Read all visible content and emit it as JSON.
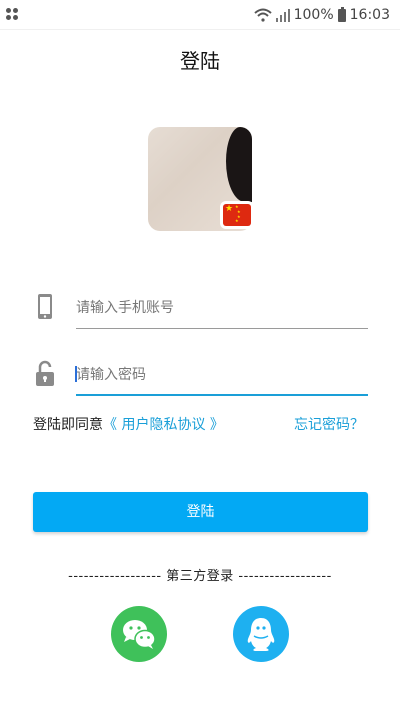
{
  "status_bar": {
    "battery_text": "100%",
    "time": "16:03",
    "icons": [
      "wifi-icon",
      "signal-icon",
      "battery-icon"
    ]
  },
  "header": {
    "title": "登陆"
  },
  "profile": {
    "avatar": "avatar-photo",
    "region_flag": "china-flag-icon"
  },
  "form": {
    "phone": {
      "placeholder": "请输入手机账号",
      "value": "",
      "icon": "phone-icon"
    },
    "password": {
      "placeholder": "请输入密码",
      "value": "",
      "icon": "lock-icon"
    }
  },
  "agreement": {
    "prefix": "登陆即同意",
    "link": "《 用户隐私协议 》",
    "forgot": "忘记密码？"
  },
  "login_button": {
    "label": "登陆"
  },
  "third_party": {
    "title": "------------------  第三方登录  ------------------",
    "providers": [
      {
        "name": "wechat",
        "icon": "wechat-icon",
        "color": "#3fc15a"
      },
      {
        "name": "qq",
        "icon": "qq-icon",
        "color": "#1eb0f0"
      }
    ]
  },
  "colors": {
    "accent": "#03a9f4",
    "link": "#1a9fd8"
  }
}
